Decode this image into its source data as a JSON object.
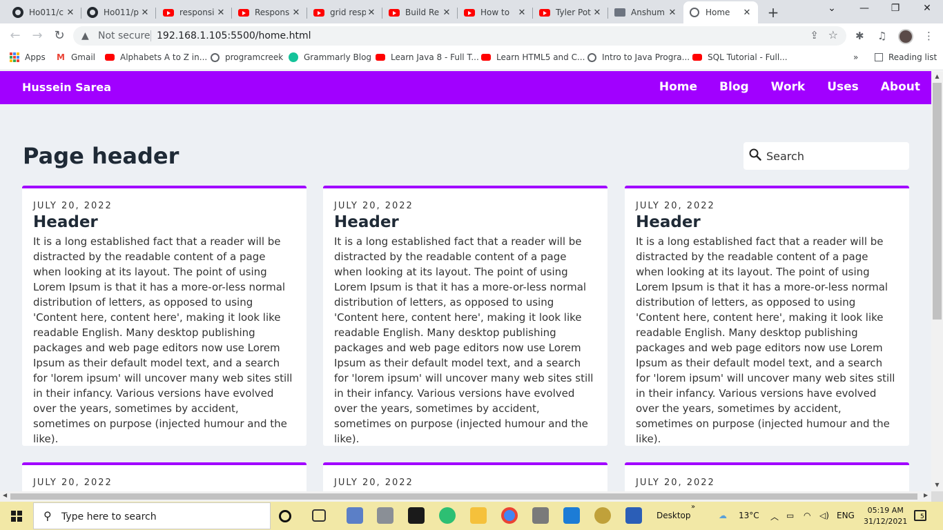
{
  "browser": {
    "tabs": [
      {
        "title": "Ho011/c",
        "icon": "github-icon"
      },
      {
        "title": "Ho011/p",
        "icon": "github-icon"
      },
      {
        "title": "responsi",
        "icon": "youtube-icon"
      },
      {
        "title": "Respons",
        "icon": "youtube-icon"
      },
      {
        "title": "grid resp",
        "icon": "youtube-icon"
      },
      {
        "title": "Build Re",
        "icon": "youtube-icon"
      },
      {
        "title": "How to",
        "icon": "youtube-icon"
      },
      {
        "title": "Tyler Pot",
        "icon": "youtube-icon"
      },
      {
        "title": "Anshum",
        "icon": "image-icon"
      },
      {
        "title": "Home",
        "icon": "globe-icon",
        "active": true
      }
    ],
    "security_label": "Not secure",
    "url": "192.168.1.105:5500/home.html",
    "bookmarks": [
      {
        "label": "Apps",
        "icon": "apps-grid-icon"
      },
      {
        "label": "Gmail",
        "icon": "gmail-icon"
      },
      {
        "label": "Alphabets A to Z in...",
        "icon": "youtube-icon"
      },
      {
        "label": "programcreek",
        "icon": "globe-icon"
      },
      {
        "label": "Grammarly Blog",
        "icon": "grammarly-icon"
      },
      {
        "label": "Learn Java 8 - Full T...",
        "icon": "youtube-icon"
      },
      {
        "label": "Learn HTML5 and C...",
        "icon": "youtube-icon"
      },
      {
        "label": "Intro to Java Progra...",
        "icon": "globe-icon"
      },
      {
        "label": "SQL Tutorial - Full...",
        "icon": "youtube-icon"
      }
    ],
    "more_bookmarks": "»",
    "reading_list": "Reading list"
  },
  "site": {
    "brand": "Hussein Sarea",
    "nav": [
      "Home",
      "Blog",
      "Work",
      "Uses",
      "About"
    ],
    "page_title": "Page header",
    "search_placeholder": "Search",
    "accent": "#a100ff",
    "cards": [
      {
        "date": "JULY 20, 2022",
        "title": "Header",
        "body": "It is a long established fact that a reader will be distracted by the readable content of a page when looking at its layout. The point of using Lorem Ipsum is that it has a more-or-less normal distribution of letters, as opposed to using 'Content here, content here', making it look like readable English. Many desktop publishing packages and web page editors now use Lorem Ipsum as their default model text, and a search for 'lorem ipsum' will uncover many web sites still in their infancy. Various versions have evolved over the years, sometimes by accident, sometimes on purpose (injected humour and the like)."
      },
      {
        "date": "JULY 20, 2022",
        "title": "Header",
        "body": "It is a long established fact that a reader will be distracted by the readable content of a page when looking at its layout. The point of using Lorem Ipsum is that it has a more-or-less normal distribution of letters, as opposed to using 'Content here, content here', making it look like readable English. Many desktop publishing packages and web page editors now use Lorem Ipsum as their default model text, and a search for 'lorem ipsum' will uncover many web sites still in their infancy. Various versions have evolved over the years, sometimes by accident, sometimes on purpose (injected humour and the like)."
      },
      {
        "date": "JULY 20, 2022",
        "title": "Header",
        "body": "It is a long established fact that a reader will be distracted by the readable content of a page when looking at its layout. The point of using Lorem Ipsum is that it has a more-or-less normal distribution of letters, as opposed to using 'Content here, content here', making it look like readable English. Many desktop publishing packages and web page editors now use Lorem Ipsum as their default model text, and a search for 'lorem ipsum' will uncover many web sites still in their infancy. Various versions have evolved over the years, sometimes by accident, sometimes on purpose (injected humour and the like)."
      },
      {
        "date": "JULY 20, 2022"
      },
      {
        "date": "JULY 20, 2022"
      },
      {
        "date": "JULY 20, 2022"
      }
    ]
  },
  "taskbar": {
    "search_placeholder": "Type here to search",
    "desktop_label": "Desktop",
    "weather": "13°C",
    "language": "ENG",
    "time": "05:19 AM",
    "date": "31/12/2021",
    "notifications": "5"
  }
}
